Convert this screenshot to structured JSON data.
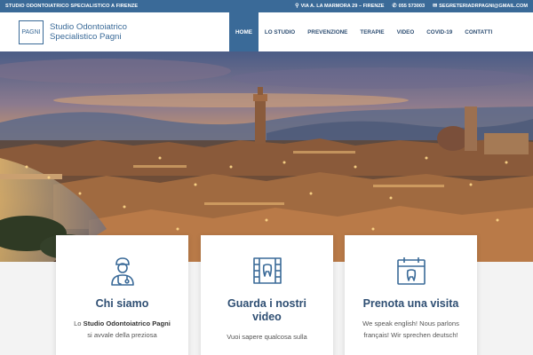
{
  "topbar": {
    "tagline": "STUDIO ODONTOIATRICO SPECIALISTICO A FIRENZE",
    "address": "VIA A. LA MARMORA 29 – FIRENZE",
    "phone": "055 573003",
    "email": "SEGRETERIADRPAGNI@GMAIL.COM"
  },
  "header": {
    "logo_text": "PAGNI",
    "brand_line1": "Studio Odontoiatrico",
    "brand_line2": "Specialistico Pagni"
  },
  "nav": {
    "items": [
      "HOME",
      "LO STUDIO",
      "PREVENZIONE",
      "TERAPIE",
      "VIDEO",
      "COVID-19",
      "CONTATTI"
    ],
    "active": "HOME"
  },
  "cards": [
    {
      "icon": "doctor-icon",
      "title_line1": "Chi siamo",
      "title_line2": "",
      "text_pre": "Lo ",
      "text_bold": "Studio Odontoiatrico Pagni",
      "text_post": " si avvale della preziosa"
    },
    {
      "icon": "video-tooth-icon",
      "title_line1": "Guarda i nostri",
      "title_line2": "video",
      "text": "Vuoi sapere qualcosa sulla"
    },
    {
      "icon": "calendar-tooth-icon",
      "title_line1": "Prenota una visita",
      "title_line2": "",
      "text": "We speak english! Nous parlons français! Wir sprechen deutsch!"
    }
  ],
  "colors": {
    "primary": "#3a6a98",
    "nav_text": "#2f4f73",
    "background": "#f3f3f3"
  }
}
